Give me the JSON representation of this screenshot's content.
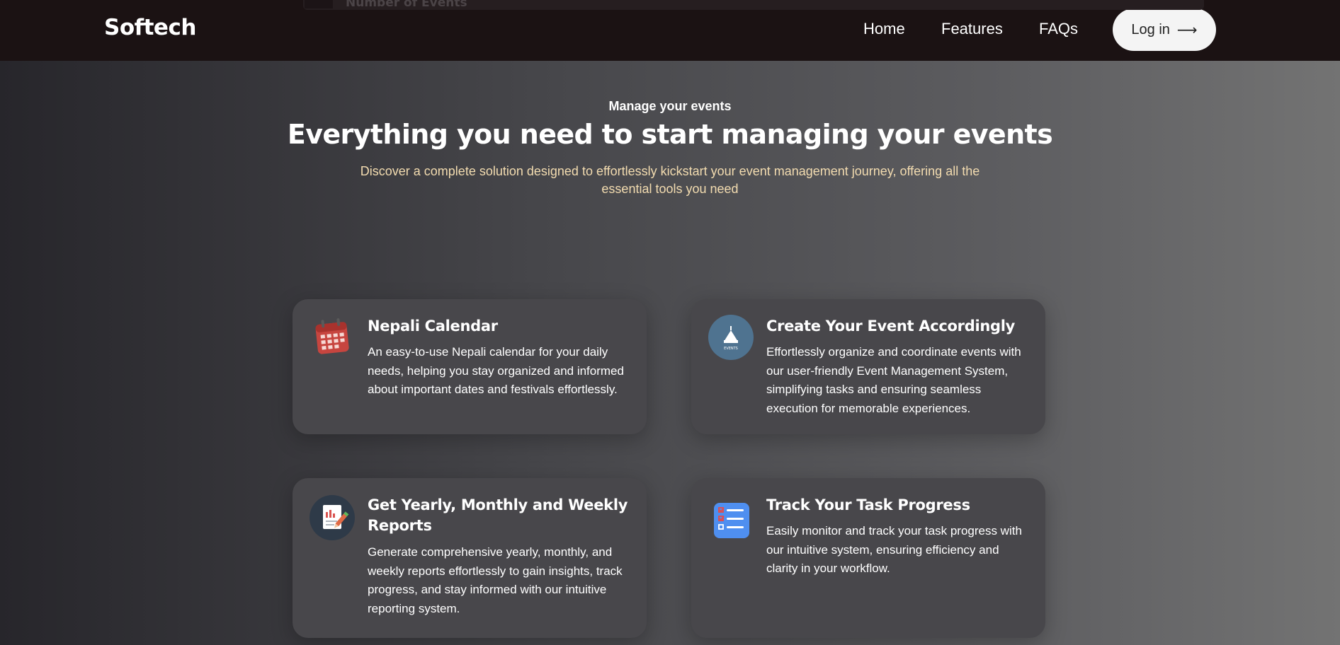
{
  "header": {
    "ghost_text": "Number of Events",
    "logo": "Softech",
    "nav": [
      {
        "label": "Home"
      },
      {
        "label": "Features"
      },
      {
        "label": "FAQs"
      }
    ],
    "login_label": "Log in",
    "login_icon": "arrow-right-icon"
  },
  "hero": {
    "eyebrow": "Manage your events",
    "headline": "Everything you need to start managing your events",
    "subline": "Discover a complete solution designed to effortlessly kickstart your event management journey, offering all the essential tools you need"
  },
  "features": [
    {
      "icon": "calendar-icon",
      "title": "Nepali Calendar",
      "description": "An easy-to-use Nepali calendar for your daily needs, helping you stay organized and informed about important dates and festivals effortlessly."
    },
    {
      "icon": "events-tent-icon",
      "icon_text": "EVENTS",
      "title": "Create Your Event Accordingly",
      "description": "Effortlessly organize and coordinate events with our user-friendly Event Management System, simplifying tasks and ensuring seamless execution for memorable experiences."
    },
    {
      "icon": "report-icon",
      "title": "Get Yearly, Monthly and Weekly Reports",
      "description": "Generate comprehensive yearly, monthly, and weekly reports effortlessly to gain insights, track progress, and stay informed with our intuitive reporting system."
    },
    {
      "icon": "checklist-icon",
      "title": "Track Your Task Progress",
      "description": "Easily monitor and track your task progress with our intuitive system, ensuring efficiency and clarity in your workflow."
    }
  ],
  "colors": {
    "navbar_bg": "#1b1213",
    "subline": "#f3dcb0",
    "card_bg": "#48474b",
    "login_bg": "#f4f4f4"
  }
}
